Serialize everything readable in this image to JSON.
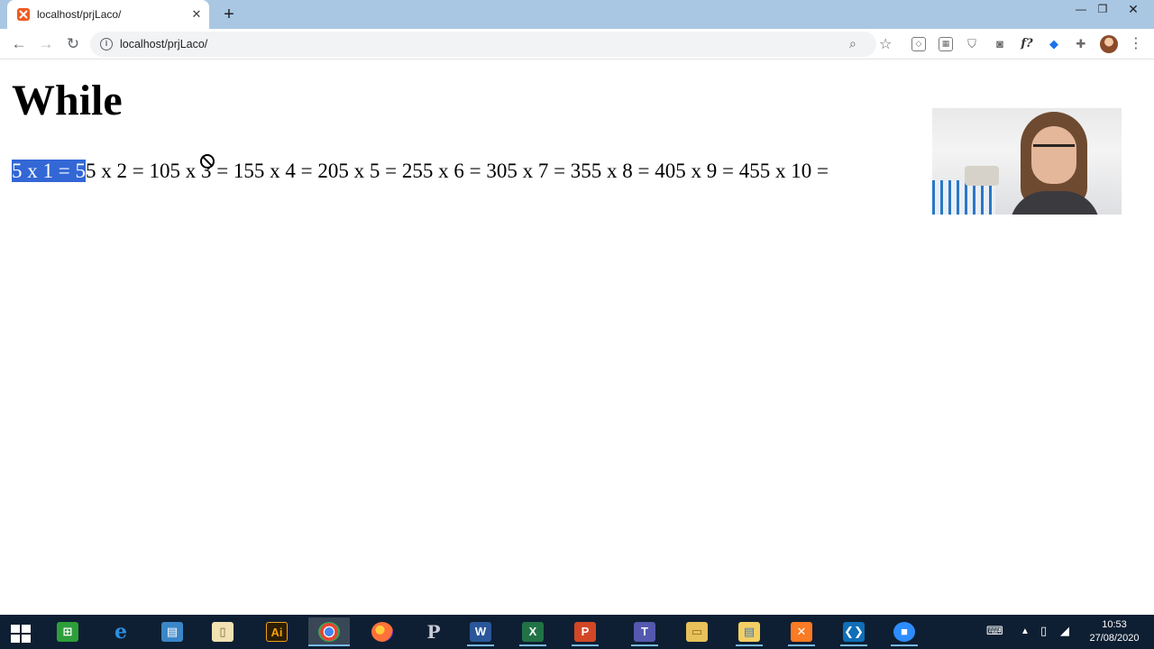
{
  "browser": {
    "tab": {
      "title": "localhost/prjLaco/",
      "favicon": "xampp-icon"
    },
    "address_bar": {
      "url": "localhost/prjLaco/"
    }
  },
  "page": {
    "heading": "While",
    "selected_text": "5 x 1 = 5",
    "output_rest": "5 x 2 = 105 x 3 = 155 x 4 = 205 x 5 = 255 x 6 = 305 x 7 = 355 x 8 = 405 x 9 = 455 x 10 ="
  },
  "taskbar": {
    "apps": [
      "start-icon",
      "store-icon",
      "ie-icon",
      "control-panel-icon",
      "file-icon",
      "illustrator-icon",
      "chrome-icon",
      "firefox-icon",
      "p-icon",
      "word-icon",
      "excel-icon",
      "powerpoint-icon",
      "teams-icon",
      "folder-icon",
      "explorer-icon",
      "xampp-icon",
      "vscode-icon",
      "zoom-icon"
    ],
    "illustrator_label": "Ai",
    "clock": {
      "time": "10:53",
      "date": "27/08/2020"
    }
  },
  "colors": {
    "tabstrip": "#a9c7e2",
    "selection": "#3367d6",
    "taskbar": "#0e1f33"
  }
}
